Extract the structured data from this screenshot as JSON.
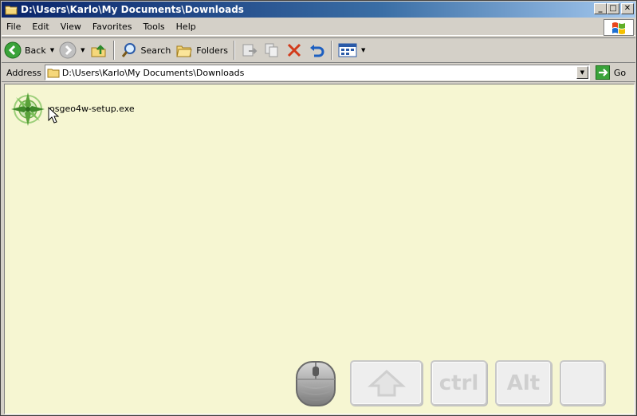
{
  "window": {
    "title": "D:\\Users\\Karlo\\My Documents\\Downloads",
    "controls": {
      "minimize": "_",
      "maximize": "□",
      "close": "✕"
    }
  },
  "menubar": {
    "items": [
      "File",
      "Edit",
      "View",
      "Favorites",
      "Tools",
      "Help"
    ]
  },
  "toolbar": {
    "back_label": "Back",
    "search_label": "Search",
    "folders_label": "Folders"
  },
  "addressbar": {
    "label": "Address",
    "value": "D:\\Users\\Karlo\\My Documents\\Downloads",
    "go_label": "Go"
  },
  "content": {
    "files": [
      {
        "name": "osgeo4w-setup.exe",
        "icon": "osgeo4w-icon"
      }
    ]
  },
  "overlay": {
    "keys": {
      "ctrl": "ctrl",
      "alt": "Alt"
    }
  },
  "colors": {
    "content_bg": "#f6f6d2",
    "chrome_bg": "#d4d0c8",
    "title_start": "#0a246a",
    "title_end": "#a6caf0"
  }
}
